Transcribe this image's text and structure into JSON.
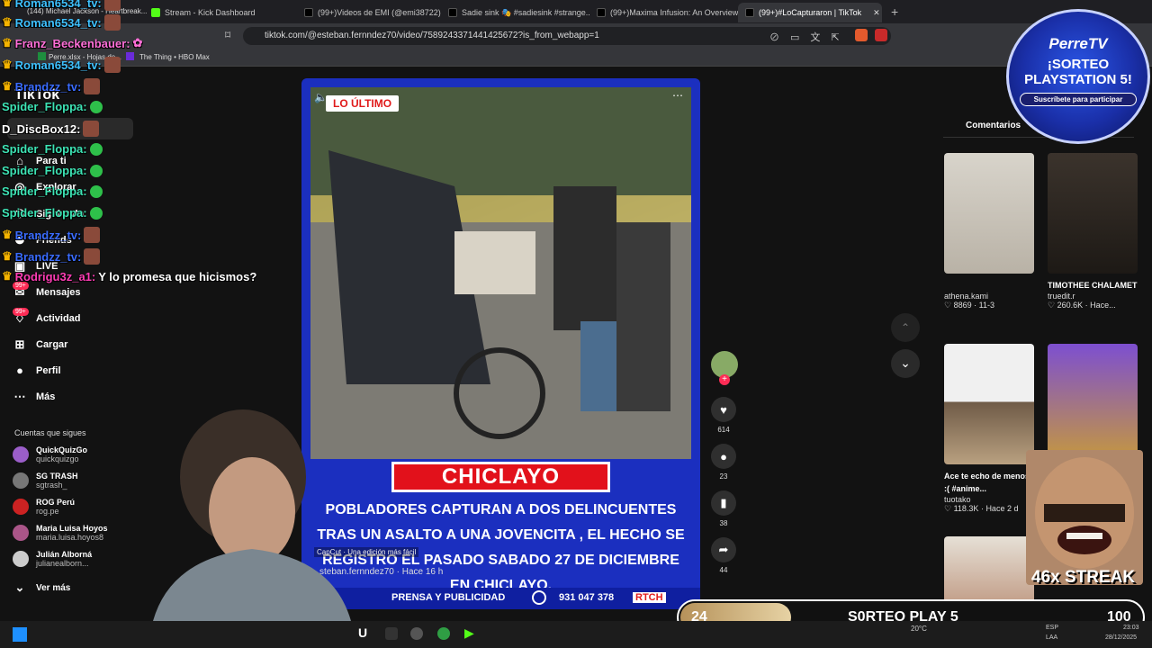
{
  "tabs": [
    {
      "label": "(144) Michael Jackson - Heartbreak...",
      "color": "#ff0000"
    },
    {
      "label": "Stream - Kick Dashboard",
      "color": "#53fc18"
    },
    {
      "label": "(99+)Videos de EMI (@emi38722) co...",
      "color": "#000000"
    },
    {
      "label": "Sadie sink 🎭 #sadiesink #strange...",
      "color": "#000000"
    },
    {
      "label": "(99+)Maxima Infusion: An Overview...",
      "color": "#000000"
    },
    {
      "label": "(99+)#LoCapturaron | TikTok",
      "color": "#000000",
      "active": true
    }
  ],
  "browser": {
    "url": "tiktok.com/@esteban.fernndez70/video/7589243371441425672?is_from_webapp=1",
    "bookmarks": [
      "Perre.xlsx - Hojas de...",
      "The Thing • HBO Max"
    ]
  },
  "tiktok": {
    "logo": "TikTok",
    "nav": [
      {
        "label": "Para ti",
        "icon": "home-icon"
      },
      {
        "label": "Explorar",
        "icon": "compass-icon"
      },
      {
        "label": "Siguiendo",
        "icon": "following-icon"
      },
      {
        "label": "Friends",
        "icon": "friends-icon"
      },
      {
        "label": "LIVE",
        "icon": "live-icon"
      },
      {
        "label": "Mensajes",
        "icon": "message-icon",
        "badge": "99+"
      },
      {
        "label": "Actividad",
        "icon": "activity-icon",
        "badge": "99+"
      },
      {
        "label": "Cargar",
        "icon": "upload-icon"
      },
      {
        "label": "Perfil",
        "icon": "profile-icon"
      },
      {
        "label": "Más",
        "icon": "more-icon"
      }
    ],
    "following_title": "Cuentas que sigues",
    "following": [
      {
        "name": "QuickQuizGo",
        "handle": "quickquizgo"
      },
      {
        "name": "SG TRASH",
        "handle": "sgtrash_"
      },
      {
        "name": "ROG Perú",
        "handle": "rog.pe"
      },
      {
        "name": "Maria Luisa Hoyos",
        "handle": "maria.luisa.hoyos8"
      },
      {
        "name": "Julián Alborná",
        "handle": "julianealborn..."
      }
    ],
    "see_more": "Ver más",
    "comments_tab": "Comentarios"
  },
  "video": {
    "tag": "LO ÚLTIMO",
    "city": "CHICLAYO",
    "headline": "POBLADORES CAPTURAN A DOS DELINCUENTES TRAS UN ASALTO A UNA JOVENCITA , EL HECHO SE REGISTRO EL PASADO SABADO 27 DE DICIEMBRE EN CHICLAYO.",
    "capcut": "CapCut · Una edición más fácil",
    "author": "steban.fernndez70 · Hace 16 h",
    "footer_label": "PRENSA Y PUBLICIDAD",
    "footer_phone": "931 047 378",
    "footer_brand": "RTCH"
  },
  "actions": [
    {
      "icon": "heart-icon",
      "count": "614"
    },
    {
      "icon": "comment-icon",
      "count": "23"
    },
    {
      "icon": "bookmark-icon",
      "count": "38"
    },
    {
      "icon": "share-icon",
      "count": "44"
    }
  ],
  "related": [
    {
      "title": "",
      "author": "athena.kami",
      "likes": "8869",
      "date": "11-3"
    },
    {
      "title": "TIMOTHEE CHALAMET IS O...",
      "author": "truedit.r",
      "likes": "260.6K",
      "date": "Hace..."
    },
    {
      "title": "Ace te echo de menos :( #anime...",
      "author": "tuotako",
      "likes": "118.3K",
      "date": "Hace 2 d"
    },
    {
      "title": "",
      "author": "",
      "likes": "",
      "date": ""
    }
  ],
  "chat": [
    {
      "user": "Roman6534_tv:",
      "color": "#3ec1ff",
      "msg": ""
    },
    {
      "user": "Roman6534_tv:",
      "color": "#3ec1ff",
      "msg": ""
    },
    {
      "user": "Franz_Beckenbauer:",
      "color": "#ff6fd8",
      "msg": ""
    },
    {
      "user": "Roman6534_tv:",
      "color": "#3ec1ff",
      "msg": ""
    },
    {
      "user": "Brandzz_tv:",
      "color": "#3a6cff",
      "msg": ""
    },
    {
      "user": "Spider_Floppa:",
      "color": "#3de3b4",
      "msg": ""
    },
    {
      "user": "D_DiscBox12:",
      "color": "#ffffff",
      "msg": ""
    },
    {
      "user": "Spider_Floppa:",
      "color": "#3de3b4",
      "msg": ""
    },
    {
      "user": "Spider_Floppa:",
      "color": "#3de3b4",
      "msg": ""
    },
    {
      "user": "Spider_Floppa:",
      "color": "#3de3b4",
      "msg": ""
    },
    {
      "user": "Spider_Floppa:",
      "color": "#3de3b4",
      "msg": ""
    },
    {
      "user": "Brandzz_tv:",
      "color": "#3a6cff",
      "msg": ""
    },
    {
      "user": "Brandzz_tv:",
      "color": "#3a6cff",
      "msg": ""
    },
    {
      "user": "Rodrigu3z_a1:",
      "color": "#ff3db4",
      "msg": "Y lo promesa que hicismos?"
    }
  ],
  "overlay": {
    "brand": "PerreTV",
    "giveaway_title": "¡SORTEO PLAYSTATION 5!",
    "giveaway_sub": "Suscríbete para participar",
    "streak": "46x STREAK",
    "bar_left": "24",
    "bar_title": "S0RTEO PLAY 5",
    "bar_right": "100",
    "bar_progress": 0.24
  },
  "taskbar": {
    "weather": "20°C",
    "lang": "ESP",
    "lang2": "LAA",
    "time": "23:03",
    "date": "28/12/2025"
  },
  "colors": {
    "accent": "#fe2c55",
    "video_bg": "#1b2fbf",
    "city_bg": "#e2111b"
  }
}
